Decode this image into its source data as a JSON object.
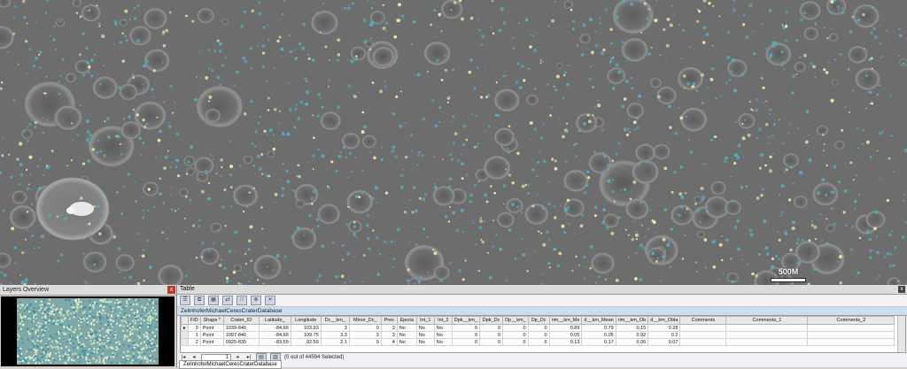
{
  "map": {
    "scale_label": "500M"
  },
  "overview": {
    "title": "Layers Overview",
    "close_label": "x"
  },
  "table_panel": {
    "title": "Table",
    "close_label": "x",
    "tab_name": "ZeilnhoferMichaelCeresCraterDatabase",
    "footer_tab": "ZeilnhoferMichaelCeresCraterDatabase",
    "columns": [
      "",
      "FID",
      "Shape *",
      "Crater_ID",
      "Latitude_",
      "Longitude",
      "Dc__km_",
      "Minor_Dc_",
      "Pres",
      "Ejecta",
      "Int_1",
      "Int_2",
      "Dpk__km_",
      "Dpk_Dc",
      "Dp__km_",
      "Dp_Dc",
      "rim__km_Me",
      "d__km_Mean",
      "rim__km_Ob",
      "d__km_Obla",
      "Comments",
      "Comments_1",
      "Comments_2"
    ],
    "rows": [
      [
        "▸",
        "0",
        "Point",
        "1039-846",
        "-84.66",
        "103.93",
        "3",
        "0",
        "3",
        "No",
        "No",
        "No",
        "0",
        "0",
        "0",
        "0",
        "0.89",
        "0.79",
        "0.15",
        "0.28",
        "",
        "",
        ""
      ],
      [
        "",
        "1",
        "Point",
        "1097-846",
        "-84.66",
        "109.75",
        "3.3",
        "3",
        "3",
        "No",
        "No",
        "No",
        "0",
        "0",
        "0",
        "0",
        "0.05",
        "0.05",
        "0.92",
        "0.2",
        "",
        "",
        ""
      ],
      [
        "",
        "2",
        "Point",
        "0925-835",
        "-83.55",
        "92.59",
        "2.1",
        "0",
        "4",
        "No",
        "No",
        "No",
        "0",
        "0",
        "0",
        "0",
        "0.13",
        "0.17",
        "0.06",
        "0.07",
        "",
        "",
        ""
      ]
    ],
    "nav": {
      "current_record": "1",
      "selection_status": "(0 out of 44594 Selected)"
    }
  },
  "colors": {
    "crater_point_cyan": "#4fb3c6",
    "crater_point_yellow": "#f2f0a8",
    "close_red": "#c0392b"
  }
}
